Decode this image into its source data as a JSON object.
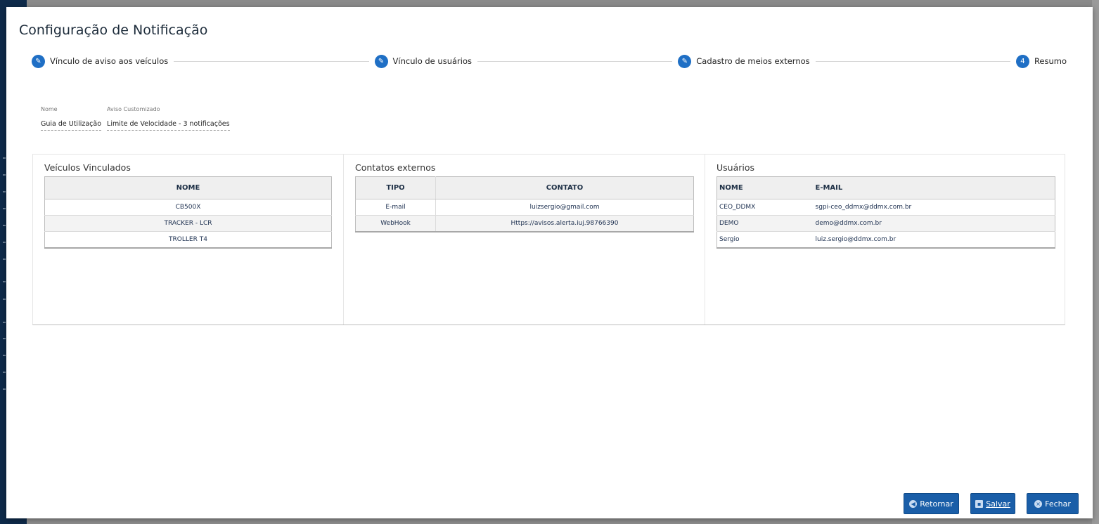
{
  "modal": {
    "title": "Configuração de Notificação"
  },
  "stepper": {
    "steps": [
      {
        "label": "Vínculo de aviso aos veículos",
        "icon": "pencil-icon",
        "marker": "✎"
      },
      {
        "label": "Vínculo de usuários",
        "icon": "pencil-icon",
        "marker": "✎"
      },
      {
        "label": "Cadastro de meios externos",
        "icon": "pencil-icon",
        "marker": "✎"
      },
      {
        "label": "Resumo",
        "icon": "step-number",
        "marker": "4"
      }
    ]
  },
  "summary": {
    "name_label": "Nome",
    "name_value": "Guia de Utilização",
    "custom_label": "Aviso Customizado",
    "custom_value": "Limite de Velocidade - 3 notificações"
  },
  "vehicles": {
    "title": "Veículos Vinculados",
    "header": "NOME",
    "rows": [
      "CB500X",
      "TRACKER - LCR",
      "TROLLER T4"
    ]
  },
  "contacts": {
    "title": "Contatos externos",
    "header_type": "TIPO",
    "header_contact": "CONTATO",
    "rows": [
      {
        "type": "E-mail",
        "contact": "luizsergio@gmail.com"
      },
      {
        "type": "WebHook",
        "contact": "Https://avisos.alerta.iuj.98766390"
      }
    ]
  },
  "users": {
    "title": "Usuários",
    "header_name": "NOME",
    "header_email": "E-MAIL",
    "rows": [
      {
        "name": "CEO_DDMX",
        "email": "sgpi-ceo_ddmx@ddmx.com.br"
      },
      {
        "name": "DEMO",
        "email": "demo@ddmx.com.br"
      },
      {
        "name": "Sergio",
        "email": "luiz.sergio@ddmx.com.br"
      }
    ]
  },
  "buttons": {
    "back": {
      "label": "Retornar",
      "icon": "arrow-left-icon"
    },
    "save": {
      "label": "Salvar",
      "icon": "save-icon"
    },
    "close": {
      "label": "Fechar",
      "icon": "close-icon"
    }
  },
  "colors": {
    "accent": "#1f6fc5",
    "button": "#1a5ea8",
    "app_sidebar": "#0e2a4a"
  }
}
